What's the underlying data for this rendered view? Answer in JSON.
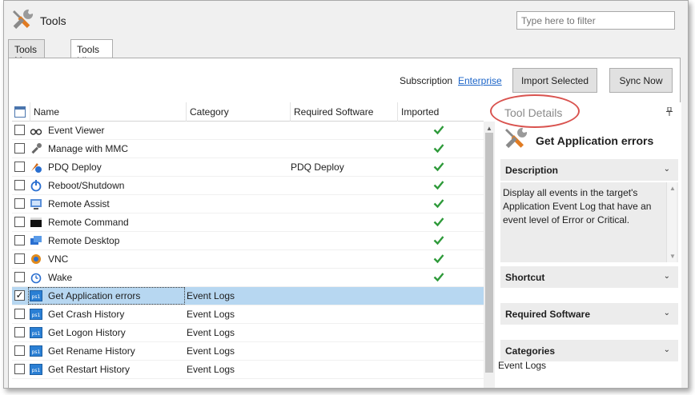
{
  "window": {
    "title": "Tools",
    "icon": "tools-wrench-icon"
  },
  "filter": {
    "placeholder": "Type here to filter"
  },
  "tabs": [
    {
      "label": "Tools Menu",
      "active": false
    },
    {
      "label": "Tools Library",
      "active": true
    }
  ],
  "toolbar": {
    "subscription_label": "Subscription",
    "subscription_value": "Enterprise",
    "import_label": "Import Selected",
    "sync_label": "Sync Now"
  },
  "grid": {
    "columns": [
      "Name",
      "Category",
      "Required Software",
      "Imported"
    ],
    "rows": [
      {
        "name": "Event Viewer",
        "category": "",
        "software": "",
        "imported": true,
        "checked": false,
        "icon": "binoculars-icon"
      },
      {
        "name": "Manage with MMC",
        "category": "",
        "software": "",
        "imported": true,
        "checked": false,
        "icon": "wrench-icon"
      },
      {
        "name": "PDQ Deploy",
        "category": "",
        "software": "PDQ Deploy",
        "imported": true,
        "checked": false,
        "icon": "pdq-deploy-icon"
      },
      {
        "name": "Reboot/Shutdown",
        "category": "",
        "software": "",
        "imported": true,
        "checked": false,
        "icon": "power-icon"
      },
      {
        "name": "Remote Assist",
        "category": "",
        "software": "",
        "imported": true,
        "checked": false,
        "icon": "remote-assist-icon"
      },
      {
        "name": "Remote Command",
        "category": "",
        "software": "",
        "imported": true,
        "checked": false,
        "icon": "terminal-icon"
      },
      {
        "name": "Remote Desktop",
        "category": "",
        "software": "",
        "imported": true,
        "checked": false,
        "icon": "remote-desktop-icon"
      },
      {
        "name": "VNC",
        "category": "",
        "software": "",
        "imported": true,
        "checked": false,
        "icon": "vnc-icon"
      },
      {
        "name": "Wake",
        "category": "",
        "software": "",
        "imported": true,
        "checked": false,
        "icon": "alarm-clock-icon"
      },
      {
        "name": "Get Application errors",
        "category": "Event Logs",
        "software": "",
        "imported": false,
        "checked": true,
        "icon": "powershell-icon"
      },
      {
        "name": "Get Crash History",
        "category": "Event Logs",
        "software": "",
        "imported": false,
        "checked": false,
        "icon": "powershell-icon"
      },
      {
        "name": "Get Logon History",
        "category": "Event Logs",
        "software": "",
        "imported": false,
        "checked": false,
        "icon": "powershell-icon"
      },
      {
        "name": "Get Rename History",
        "category": "Event Logs",
        "software": "",
        "imported": false,
        "checked": false,
        "icon": "powershell-icon"
      },
      {
        "name": "Get Restart History",
        "category": "Event Logs",
        "software": "",
        "imported": false,
        "checked": false,
        "icon": "powershell-icon"
      }
    ]
  },
  "details": {
    "panel_title": "Tool Details",
    "tool_name": "Get Application errors",
    "sections": {
      "description": "Description",
      "shortcut": "Shortcut",
      "required_software": "Required Software",
      "categories": "Categories"
    },
    "description_text": "Display all events in the target's Application Event Log that have an event level of Error or Critical.",
    "categories_value": "Event Logs"
  },
  "colors": {
    "selected_row": "#b7d7f1",
    "link": "#1b64c8",
    "check": "#2e9a3a",
    "annotation": "#d9534f"
  }
}
